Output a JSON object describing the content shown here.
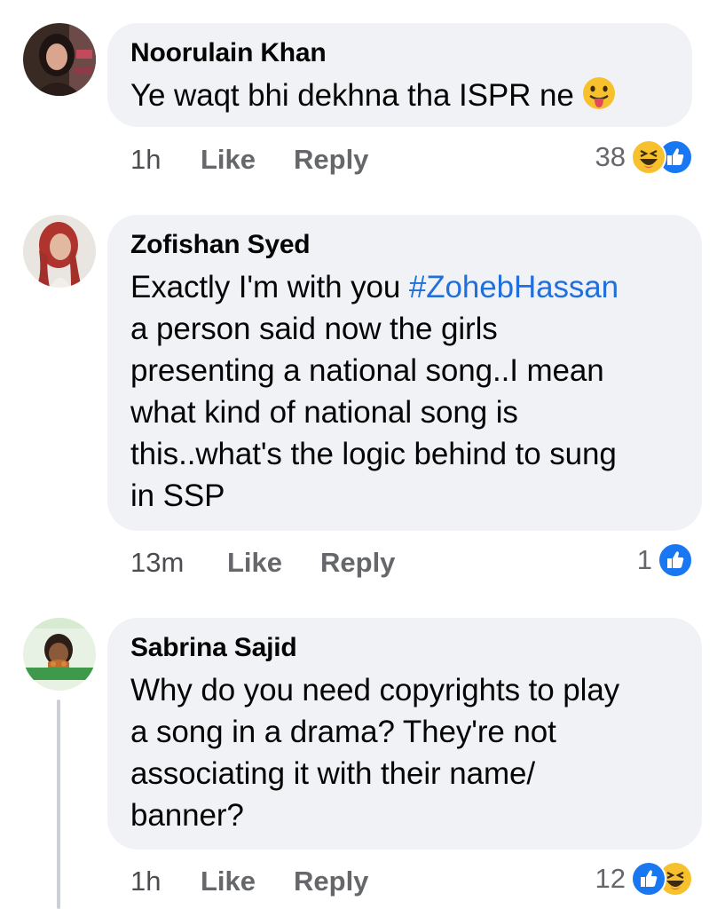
{
  "comments": [
    {
      "author": "Noorulain Khan",
      "text": "Ye waqt bhi dekhna tha ISPR ne",
      "emoji": "tongue-out-emoji",
      "time": "1h",
      "like_label": "Like",
      "reply_label": "Reply",
      "reaction_count": "38",
      "reaction_icons": [
        "haha-icon",
        "like-icon"
      ]
    },
    {
      "author": "Zofishan Syed",
      "text_before": "Exactly I'm with you ",
      "hashtag": "#ZohebHassan",
      "text_after_lines": [
        "a person said now the girls",
        "presenting a national song..I mean",
        "what kind of national song is",
        "this..what's the logic behind to sung",
        "in SSP"
      ],
      "time": "13m",
      "like_label": "Like",
      "reply_label": "Reply",
      "reaction_count": "1",
      "reaction_icons": [
        "like-icon"
      ]
    },
    {
      "author": "Sabrina Sajid",
      "text_lines": [
        "Why do you need copyrights to play",
        "a song in a drama? They're not",
        "associating it with their name/",
        "banner?"
      ],
      "time": "1h",
      "like_label": "Like",
      "reply_label": "Reply",
      "reaction_count": "12",
      "reaction_icons": [
        "like-icon",
        "haha-icon"
      ]
    }
  ],
  "colors": {
    "bubble": "#f0f2f5",
    "hashtag": "#216fdb",
    "meta": "#65676b",
    "like": "#1a77f2",
    "haha": "#f7c12e"
  }
}
